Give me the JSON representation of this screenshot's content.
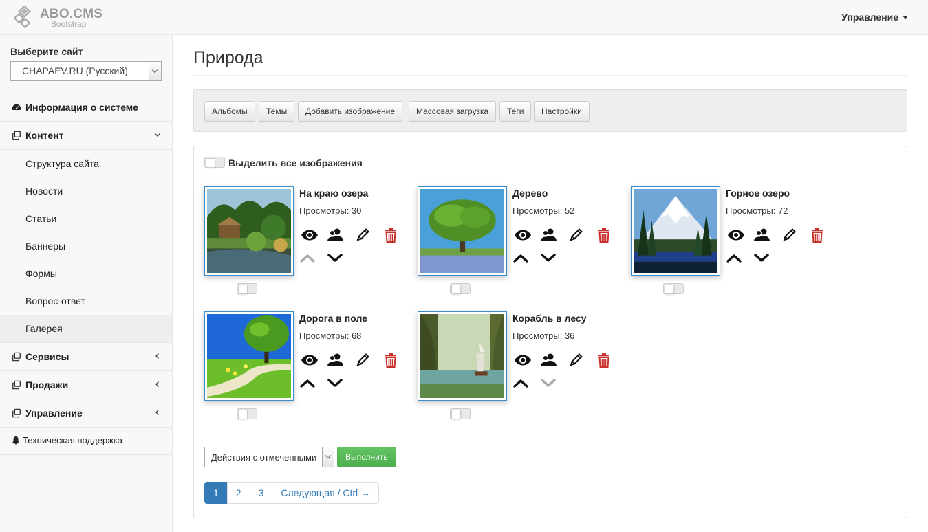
{
  "app": {
    "logo_text": "ABO.CMS",
    "logo_sub": "Bootstrap",
    "top_menu_label": "Управление"
  },
  "sidebar": {
    "site_label": "Выберите сайт",
    "site_value": "CHAPAEV.RU (Русский)",
    "items": [
      {
        "label": "Информация о системе",
        "icon": "dashboard-icon"
      },
      {
        "label": "Контент",
        "icon": "copy-icon",
        "expanded": true
      },
      {
        "label": "Сервисы",
        "icon": "copy-icon"
      },
      {
        "label": "Продажи",
        "icon": "copy-icon"
      },
      {
        "label": "Управление",
        "icon": "copy-icon"
      }
    ],
    "content_sub": [
      "Структура сайта",
      "Новости",
      "Статьи",
      "Баннеры",
      "Формы",
      "Вопрос-ответ",
      "Галерея"
    ],
    "active_sub": "Галерея",
    "support_label": "Техническая поддержка"
  },
  "main": {
    "title": "Природа",
    "toolbar": [
      "Альбомы",
      "Темы",
      "Добавить изображение",
      "Массовая загрузка",
      "Теги",
      "Настройки"
    ],
    "select_all_label": "Выделить все изображения",
    "views_prefix": "Просмотры:",
    "images": [
      {
        "title": "На краю озера",
        "views": "30",
        "up_enabled": false,
        "down_enabled": true
      },
      {
        "title": "Дерево",
        "views": "52",
        "up_enabled": true,
        "down_enabled": true
      },
      {
        "title": "Горное озеро",
        "views": "72",
        "up_enabled": true,
        "down_enabled": true
      },
      {
        "title": "Дорога в поле",
        "views": "68",
        "up_enabled": true,
        "down_enabled": true
      },
      {
        "title": "Корабль в лесу",
        "views": "36",
        "up_enabled": true,
        "down_enabled": false
      }
    ],
    "bulk_action_value": "Действия с отмеченными",
    "run_label": "Выполнить",
    "pages": [
      "1",
      "2",
      "3"
    ],
    "active_page": "1",
    "next_label": "Следующая / Ctrl →"
  },
  "colors": {
    "accent": "#337ab7",
    "thumb_border": "#3a8dc9",
    "delete": "#c9302c",
    "success": "#5cb85c"
  }
}
